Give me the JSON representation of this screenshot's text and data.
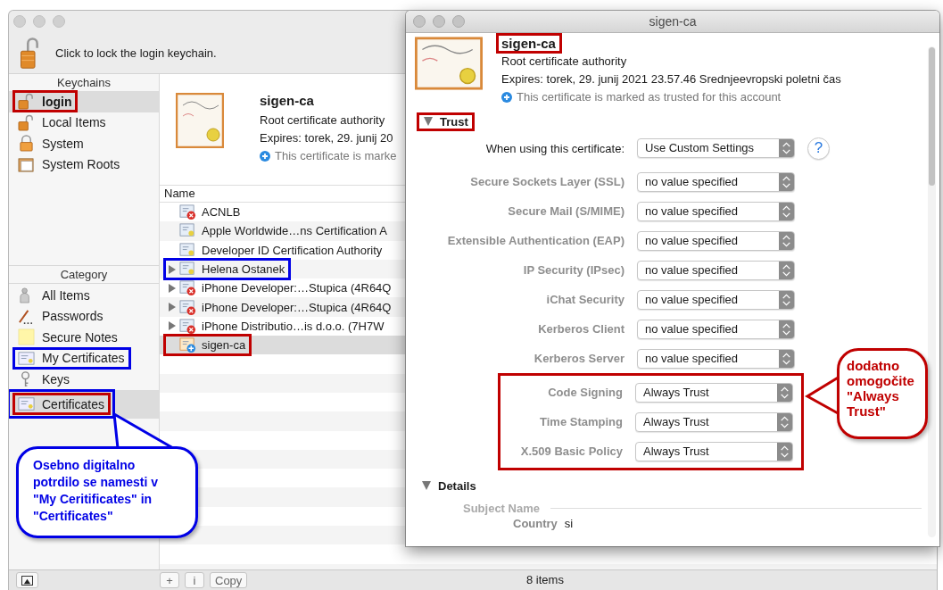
{
  "keychain_window": {
    "lock_message": "Click to lock the login keychain.",
    "keychains_header": "Keychains",
    "keychains": [
      {
        "label": "login",
        "selected": true,
        "highlight": {
          "color": "#c00000"
        }
      },
      {
        "label": "Local Items",
        "selected": false
      },
      {
        "label": "System",
        "selected": false
      },
      {
        "label": "System Roots",
        "selected": false
      }
    ],
    "category_header": "Category",
    "categories": [
      {
        "label": "All Items",
        "selected": false
      },
      {
        "label": "Passwords",
        "selected": false
      },
      {
        "label": "Secure Notes",
        "selected": false
      },
      {
        "label": "My Certificates",
        "selected": false,
        "highlight": {
          "color": "#0000e6"
        }
      },
      {
        "label": "Keys",
        "selected": false
      },
      {
        "label": "Certificates",
        "selected": true,
        "highlight": {
          "color": "#c00000",
          "outer": {
            "color": "#0000e6"
          }
        }
      }
    ],
    "certificate": {
      "name": "sigen-ca",
      "type": "Root certificate authority",
      "expires": "Expires: torek, 29. junij 20",
      "trust_note": "This certificate is marke"
    },
    "list": {
      "column": "Name",
      "rows": [
        {
          "name": "ACNLB",
          "kind": "invalid",
          "disclosure": false,
          "selected": false
        },
        {
          "name": "Apple Worldwide…ns Certification A",
          "kind": "plain",
          "disclosure": false,
          "selected": false
        },
        {
          "name": "Developer ID Certification Authority",
          "kind": "plain",
          "disclosure": false,
          "selected": false
        },
        {
          "name": "Helena Ostanek",
          "kind": "plain",
          "disclosure": true,
          "selected": false,
          "highlight": {
            "color": "#0000e6"
          }
        },
        {
          "name": "iPhone Developer:…Stupica (4R64Q",
          "kind": "invalid",
          "disclosure": true,
          "selected": false
        },
        {
          "name": "iPhone Developer:…Stupica (4R64Q",
          "kind": "invalid",
          "disclosure": true,
          "selected": false
        },
        {
          "name": "iPhone Distributio…is d.o.o. (7H7W",
          "kind": "invalid",
          "disclosure": true,
          "selected": false
        },
        {
          "name": "sigen-ca",
          "kind": "trusted",
          "disclosure": false,
          "selected": true,
          "highlight": {
            "color": "#c00000"
          }
        }
      ]
    },
    "bottom_bar": {
      "buttons": [
        "+",
        "i",
        "Copy"
      ],
      "count": "8 items"
    }
  },
  "certificate_window": {
    "title": "sigen-ca",
    "name": {
      "text": "sigen-ca",
      "highlight": {
        "color": "#c00000"
      }
    },
    "type": "Root certificate authority",
    "expires": "Expires: torek, 29. junij 2021 23.57.46 Srednjeevropski poletni čas",
    "trust_note": "This certificate is marked as trusted for this account",
    "trust_section": {
      "label": "Trust",
      "expanded": true,
      "highlight": {
        "color": "#c00000"
      }
    },
    "policy": {
      "label": "When using this certificate:",
      "value": "Use Custom Settings",
      "help": "?"
    },
    "settings": [
      {
        "label": "Secure Sockets Layer (SSL)",
        "value": "no value specified",
        "disabled": true
      },
      {
        "label": "Secure Mail (S/MIME)",
        "value": "no value specified",
        "disabled": true
      },
      {
        "label": "Extensible Authentication (EAP)",
        "value": "no value specified",
        "disabled": true
      },
      {
        "label": "IP Security (IPsec)",
        "value": "no value specified",
        "disabled": true
      },
      {
        "label": "iChat Security",
        "value": "no value specified",
        "disabled": true
      },
      {
        "label": "Kerberos Client",
        "value": "no value specified",
        "disabled": true
      },
      {
        "label": "Kerberos Server",
        "value": "no value specified",
        "disabled": true
      }
    ],
    "marked_settings_highlight": {
      "color": "#c00000"
    },
    "marked_settings": [
      {
        "label": "Code Signing",
        "value": "Always Trust",
        "disabled": true
      },
      {
        "label": "Time Stamping",
        "value": "Always Trust",
        "disabled": true
      },
      {
        "label": "X.509 Basic Policy",
        "value": "Always Trust",
        "disabled": true
      }
    ],
    "details": {
      "label": "Details",
      "expanded": true,
      "subject_heading": "Subject Name",
      "fields": [
        {
          "label": "Country",
          "value": "si"
        }
      ]
    }
  },
  "callouts": [
    {
      "kind": "sidebar-note",
      "color": "#0000e6",
      "text": "Osebno digitalno potrdilo se namesti v \"My Ceritificates\" in \"Certificates\""
    },
    {
      "kind": "trust-note",
      "color": "#c00000",
      "text": "dodatno omogočite \"Always Trust\""
    }
  ]
}
